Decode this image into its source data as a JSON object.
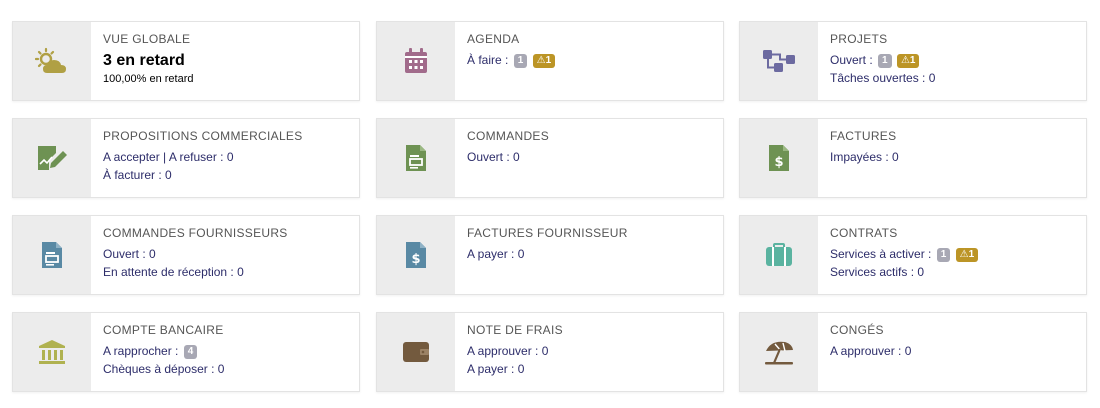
{
  "cards": [
    {
      "key": "global",
      "title": "VUE GLOBALE",
      "big": "3 en retard",
      "sub": "100,00% en retard",
      "icon": "weather-icon",
      "icon_color": "#b0a044"
    },
    {
      "key": "agenda",
      "title": "AGENDA",
      "line1": "À faire :",
      "b1": "1",
      "w1": "1",
      "icon": "calendar-icon",
      "icon_color": "#a16b8b"
    },
    {
      "key": "projets",
      "title": "PROJETS",
      "line1": "Ouvert :",
      "b1": "1",
      "w1": "1",
      "line2": "Tâches ouvertes : 0",
      "icon": "project-icon",
      "icon_color": "#6c6aa0"
    },
    {
      "key": "propal",
      "title": "PROPOSITIONS COMMERCIALES",
      "line1": "A accepter | A refuser : 0",
      "line2": "À facturer : 0",
      "icon": "proposal-icon",
      "icon_color": "#6e9253"
    },
    {
      "key": "commandes",
      "title": "COMMANDES",
      "line1": "Ouvert : 0",
      "icon": "order-icon",
      "icon_color": "#6e9253"
    },
    {
      "key": "factures",
      "title": "FACTURES",
      "line1": "Impayées : 0",
      "icon": "invoice-icon",
      "icon_color": "#6e9253"
    },
    {
      "key": "cmdfourn",
      "title": "COMMANDES FOURNISSEURS",
      "line1": "Ouvert : 0",
      "line2": "En attente de réception : 0",
      "icon": "supplier-order-icon",
      "icon_color": "#5989a4"
    },
    {
      "key": "factfourn",
      "title": "FACTURES FOURNISSEUR",
      "line1": "A payer : 0",
      "icon": "supplier-invoice-icon",
      "icon_color": "#5989a4"
    },
    {
      "key": "contrats",
      "title": "CONTRATS",
      "line1": "Services à activer :",
      "b1": "1",
      "w1": "1",
      "line2": "Services actifs : 0",
      "icon": "briefcase-icon",
      "icon_color": "#5ab3a0"
    },
    {
      "key": "banque",
      "title": "COMPTE BANCAIRE",
      "line1": "A rapprocher :",
      "b1": "4",
      "line2": "Chèques à déposer : 0",
      "icon": "bank-icon",
      "icon_color": "#b0b250"
    },
    {
      "key": "frais",
      "title": "NOTE DE FRAIS",
      "line1": "A approuver : 0",
      "line2": "A payer : 0",
      "icon": "wallet-icon",
      "icon_color": "#735a3e"
    },
    {
      "key": "conges",
      "title": "CONGÉS",
      "line1": "A approuver : 0",
      "icon": "beach-icon",
      "icon_color": "#735a3e"
    }
  ]
}
